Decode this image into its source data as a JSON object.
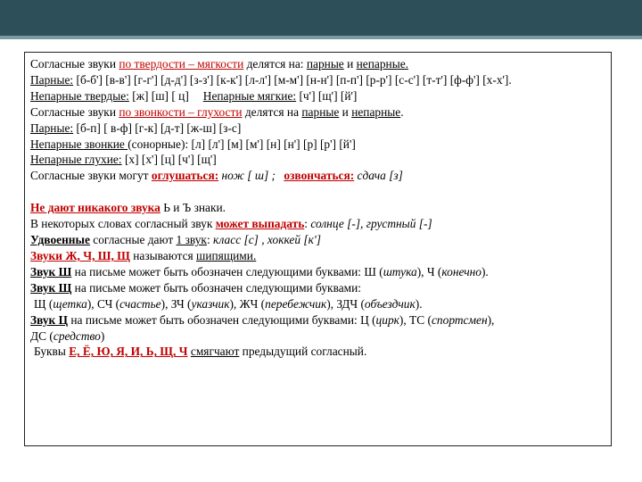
{
  "colors": {
    "header_bar": "#2c4f5a",
    "accent_red": "#c00000",
    "text": "#000000"
  },
  "lines": {
    "l1": {
      "a": "Согласные звуки ",
      "b": "по твердости – мягкости",
      "c": " делятся на: ",
      "d": "парные",
      "e": " и ",
      "f": "непарные."
    },
    "l2": {
      "a": "Парные:",
      "b": " [б-б'] [в-в'] [г-г'] [д-д'] [з-з'] [к-к'] [л-л'] [м-м'] [н-н'] [п-п'] [р-р'] [с-с'] [т-т'] [ф-ф'] [х-х']."
    },
    "l3": {
      "a": "Непарные твердые:",
      "b": " [ж] [ш] [ ц]",
      "c": "Непарные мягкие:",
      "d": " [ч'] [щ'] [й']"
    },
    "l4": {
      "a": "Согласные звуки ",
      "b": "по звонкости – глухости",
      "c": " делятся на ",
      "d": "парные",
      "e": " и ",
      "f": "непарные",
      "g": "."
    },
    "l5": {
      "a": "Парные:",
      "b": " [б-п] [ в-ф] [г-к] [д-т] [ж-ш] [з-с]"
    },
    "l6": {
      "a": "Непарные звонкие ",
      "b": "(сонорные): [л] [л'] [м] [м'] [н] [н'] [р] [р'] [й']"
    },
    "l7": {
      "a": "Непарные глухие:",
      "b": " [х] [х'] [ц] [ч'] [щ']"
    },
    "l8": {
      "a": "Согласные звуки могут ",
      "b": "оглушаться:",
      "c": " нож [ ш] ; ",
      "d": "озвончаться:",
      "e": " сдача [з]"
    },
    "l9": {
      "a": "Не дают никакого звука",
      "b": " Ь и Ъ знаки."
    },
    "l10": {
      "a": "В некоторых словах согласный звук ",
      "b": "может выпадать",
      "c": ": ",
      "d": "солнце [-], грустный [-]"
    },
    "l11": {
      "a": "Удвоенные",
      "b": " согласные дают ",
      "c": "1 звук",
      "d": ": ",
      "e": "класс [с] , хоккей [к']"
    },
    "l12": {
      "a": "Звуки Ж, Ч, Ш, Щ",
      "b": " называются ",
      "c": "шипящими."
    },
    "l13": {
      "a": "Звук Ш",
      "b": " на письме может быть обозначен следующими буквами: Ш (",
      "c": "штука",
      "d": "), Ч (",
      "e": "конечно",
      "f": ")."
    },
    "l14": {
      "a": "Звук Щ",
      "b": " на письме может быть обозначен следующими буквами:"
    },
    "l15": {
      "a": "Щ (",
      "b": "щетка",
      "c": "), СЧ (",
      "d": "счастье",
      "e": "), ЗЧ (",
      "f": "указчик",
      "g": "), ЖЧ (",
      "h": "перебежчик",
      "i": "), ЗДЧ (",
      "j": "объездчик",
      "k": ")."
    },
    "l16": {
      "a": "Звук Ц",
      "b": " на письме может быть обозначен следующими буквами: Ц (",
      "c": "цирк",
      "d": "), ТС (",
      "e": "спортсмен",
      "f": "),"
    },
    "l17": {
      "a": "ДС (",
      "b": "средство",
      "c": ")"
    },
    "l18": {
      "a": "Буквы ",
      "b": "Е, Ё, Ю, Я, И, Ь, Щ, Ч",
      "c": " ",
      "d": "смягчают",
      "e": " предыдущий согласный."
    }
  }
}
